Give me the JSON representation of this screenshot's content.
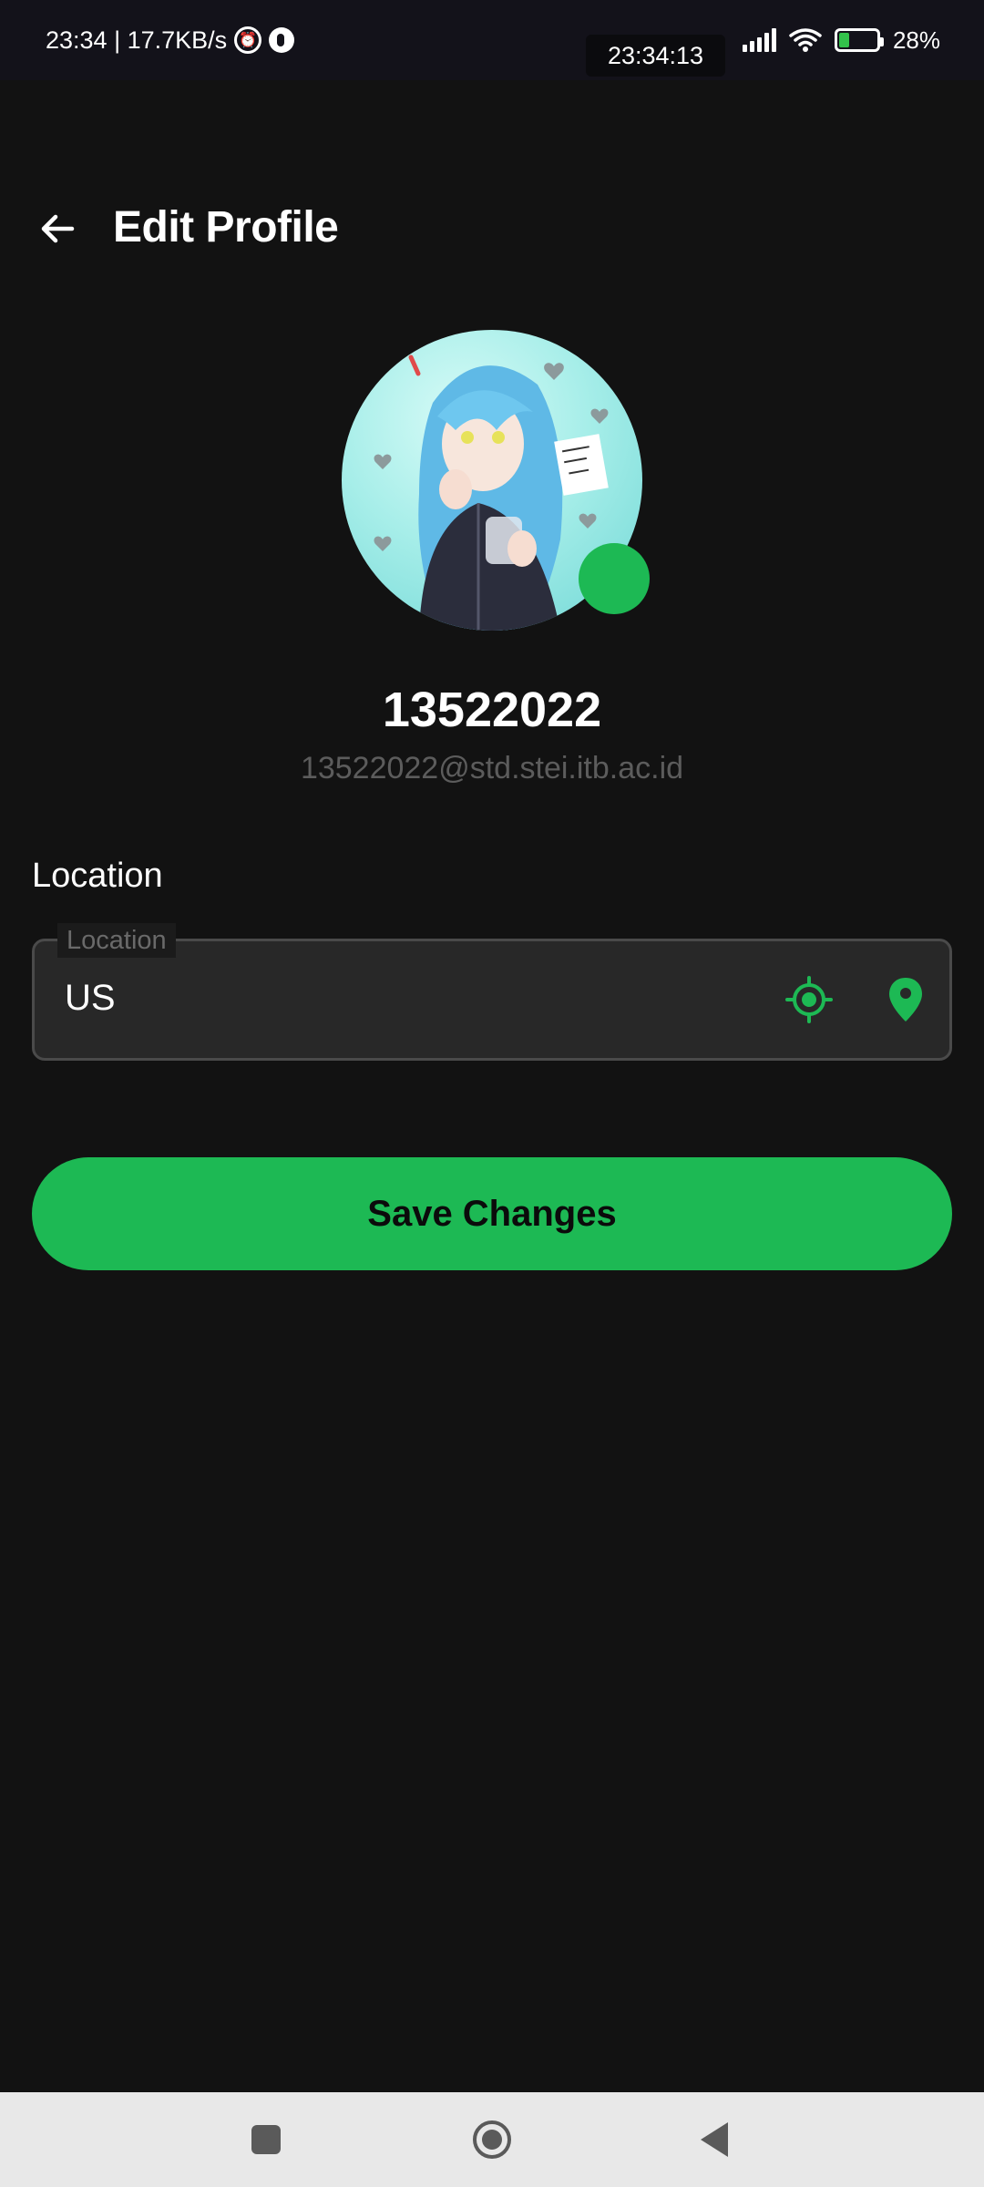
{
  "status_bar": {
    "time_speed": "23:34 | 17.7KB/s",
    "clock": "23:34:13",
    "battery_percent": "28%",
    "battery_level": 0.28,
    "colors": {
      "battery_fill": "#33c14b"
    }
  },
  "header": {
    "title": "Edit Profile",
    "back_icon": "arrow-left-icon"
  },
  "profile": {
    "username": "13522022",
    "email": "13522022@std.stei.itb.ac.id"
  },
  "location": {
    "section_label": "Location",
    "field_label": "Location",
    "value": "US",
    "current_location_icon": "gps-crosshair-icon",
    "pick_on_map_icon": "map-pin-icon"
  },
  "actions": {
    "save_label": "Save Changes"
  },
  "nav_bar": {
    "icons": [
      "recents-square-icon",
      "home-circle-icon",
      "back-triangle-icon"
    ]
  },
  "theme": {
    "background": "#121212",
    "accent": "#1db954",
    "muted_text": "#5c5c5c"
  }
}
